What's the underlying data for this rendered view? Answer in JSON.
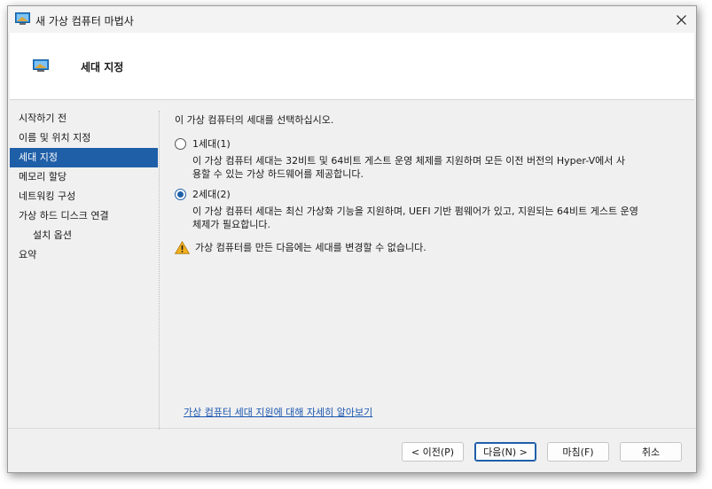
{
  "window": {
    "title": "새 가상 컴퓨터 마법사",
    "header_title": "세대 지정"
  },
  "nav": {
    "items": [
      {
        "label": "시작하기 전"
      },
      {
        "label": "이름 및 위치 지정"
      },
      {
        "label": "세대 지정"
      },
      {
        "label": "메모리 할당"
      },
      {
        "label": "네트워킹 구성"
      },
      {
        "label": "가상 하드 디스크 연결"
      },
      {
        "label": "설치 옵션"
      },
      {
        "label": "요약"
      }
    ],
    "selected_index": 2
  },
  "content": {
    "intro": "이 가상 컴퓨터의 세대를 선택하십시오.",
    "gen1": {
      "label": "1세대(1)",
      "selected": false,
      "desc_line1": "이 가상 컴퓨터 세대는 32비트 및 64비트 게스트 운영 체제를 지원하며 모든 이전 버전의 Hyper-V에서 사",
      "desc_line2": "용할 수 있는 가상 하드웨어를 제공합니다."
    },
    "gen2": {
      "label": "2세대(2)",
      "selected": true,
      "desc_line1": "이 가상 컴퓨터 세대는 최신 가상화 기능을 지원하며, UEFI 기반 펌웨어가 있고, 지원되는 64비트 게스트 운영",
      "desc_line2": "체제가 필요합니다."
    },
    "warning": "가상 컴퓨터를 만든 다음에는 세대를 변경할 수 없습니다.",
    "help_link": "가상 컴퓨터 세대 지원에 대해 자세히 알아보기"
  },
  "buttons": {
    "prev": "< 이전(P)",
    "next": "다음(N) >",
    "finish": "마침(F)",
    "cancel": "취소"
  },
  "colors": {
    "accent": "#1f5fa8",
    "link": "#1a56b0",
    "warning": "#f2b01e"
  }
}
